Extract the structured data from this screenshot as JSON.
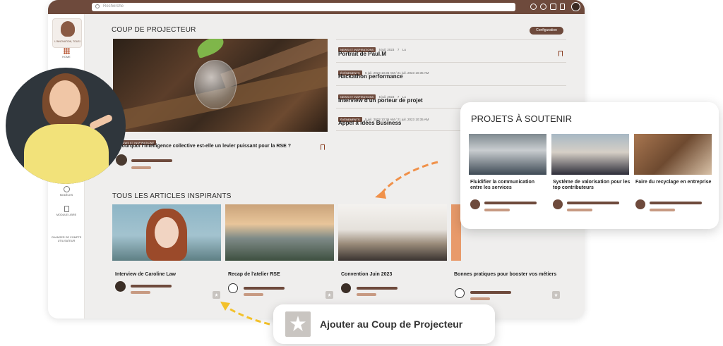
{
  "search": {
    "placeholder": "Recherche"
  },
  "logo": {
    "text": "L'INNOVATION, TOUS !"
  },
  "sidebar": {
    "items": [
      {
        "label": "HOME"
      },
      {
        "label": "MODÈLES"
      },
      {
        "label": "MODULE LIBRE"
      },
      {
        "label": "CHANGER DE COMPTE UTILISATEUR"
      }
    ]
  },
  "spotlight": {
    "heading": "COUP DE PROJECTEUR",
    "config_label": "Configuration",
    "featured": {
      "tag": "NEWS ET INSPIRATIONS",
      "title": "Pourquoi l'intelligence collective est-elle un levier puissant pour la RSE ?"
    },
    "news": [
      {
        "tag": "NEWS ET INSPIRATIONS",
        "date": "5 juil. 2023",
        "views": "7",
        "status": "Lu",
        "title": "Portrait de Paul.M"
      },
      {
        "tag": "ÉVÉNEMENTS",
        "date": "5 juil. 2023 10:36 AM / 21 juil. 2023 10:35 AM",
        "title": "Hackathon performance"
      },
      {
        "tag": "NEWS ET INSPIRATIONS",
        "date": "5 juil. 2023",
        "views": "7",
        "status": "Lu",
        "title": "Interview d'un porteur de projet"
      },
      {
        "tag": "ÉVÉNEMENTS",
        "date": "5 juil. 2023 10:36 AM / 21 juil. 2023 10:35 AM",
        "title": "Appel à idées Business"
      }
    ]
  },
  "articles": {
    "heading": "TOUS LES ARTICLES INSPIRANTS",
    "cards": [
      {
        "title": "Interview de Caroline Law"
      },
      {
        "title": "Recap de l'atelier RSE"
      },
      {
        "title": "Convention Juin 2023"
      },
      {
        "title": "Bonnes pratiques pour booster vos métiers"
      }
    ]
  },
  "projets": {
    "heading": "PROJETS À SOUTENIR",
    "cards": [
      {
        "title": "Fluidifier la communication entre les services"
      },
      {
        "title": "Système de valorisation pour les top contributeurs"
      },
      {
        "title": "Faire du recyclage en entreprise"
      }
    ]
  },
  "add_spotlight": {
    "label": "Ajouter au Coup de Projecteur"
  },
  "colors": {
    "brand": "#6e4a3c",
    "accent": "#f0914a",
    "bookmark": "#8a3e22"
  }
}
